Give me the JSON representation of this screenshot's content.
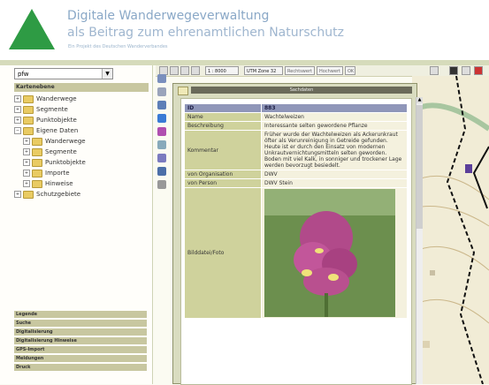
{
  "header": {
    "title_line1": "Digitale Wanderwegeverwaltung",
    "title_line2": "als Beitrag zum ehrenamtlichen Naturschutz",
    "subtitle": "Ein Projekt des Deutschen Wanderverbandes"
  },
  "left": {
    "select_value": "pfw",
    "panel_title": "Kartenebene",
    "tree": [
      {
        "label": "Wanderwege",
        "level": 1,
        "exp": "+"
      },
      {
        "label": "Segmente",
        "level": 1,
        "exp": "+"
      },
      {
        "label": "Punktobjekte",
        "level": 1,
        "exp": "+"
      },
      {
        "label": "Eigene Daten",
        "level": 1,
        "exp": "−"
      },
      {
        "label": "Wanderwege",
        "level": 2,
        "exp": "+"
      },
      {
        "label": "Segmente",
        "level": 2,
        "exp": "+"
      },
      {
        "label": "Punktobjekte",
        "level": 2,
        "exp": "+"
      },
      {
        "label": "Importe",
        "level": 2,
        "exp": "+"
      },
      {
        "label": "Hinweise",
        "level": 2,
        "exp": "+"
      },
      {
        "label": "Schutzgebiete",
        "level": 1,
        "exp": "+"
      }
    ],
    "accordion": [
      "Legende",
      "Suche",
      "Digitalisierung",
      "Digitalisierung Hinweise",
      "GPS-Import",
      "Meldungen",
      "Druck"
    ]
  },
  "toolbar": {
    "scale": "1 : 8000",
    "crs": "UTM Zone 32",
    "field1": "Rechtswert",
    "field2": "Hochwert",
    "go": "OK"
  },
  "popup": {
    "title": "Sachdaten",
    "rows": [
      {
        "k": "ID",
        "v": "883",
        "head": true
      },
      {
        "k": "Name",
        "v": "Wachtelweizen"
      },
      {
        "k": "Beschreibung",
        "v": "Interessante selten gewordene Pflanze"
      },
      {
        "k": "Kommentar",
        "v": "Früher wurde der Wachtelweizen als Ackerunkraut öfter als Verunreinigung in Getreide gefunden. Heute ist er durch den Einsatz von modernen Unkrautvernichtungsmitteln selten geworden. Boden mit viel Kalk, in sonniger und trockener Lage werden bevorzugt besiedelt."
      },
      {
        "k": "von Organisation",
        "v": "DWV"
      },
      {
        "k": "von Person",
        "v": "DWV Stein"
      },
      {
        "k": "Bilddatei/Foto",
        "v": ""
      }
    ]
  },
  "colors": {
    "logo": "#2e9b44",
    "title": "#8aa8c7",
    "keycell": "#cfd29c",
    "headrow": "#8f96b9"
  }
}
